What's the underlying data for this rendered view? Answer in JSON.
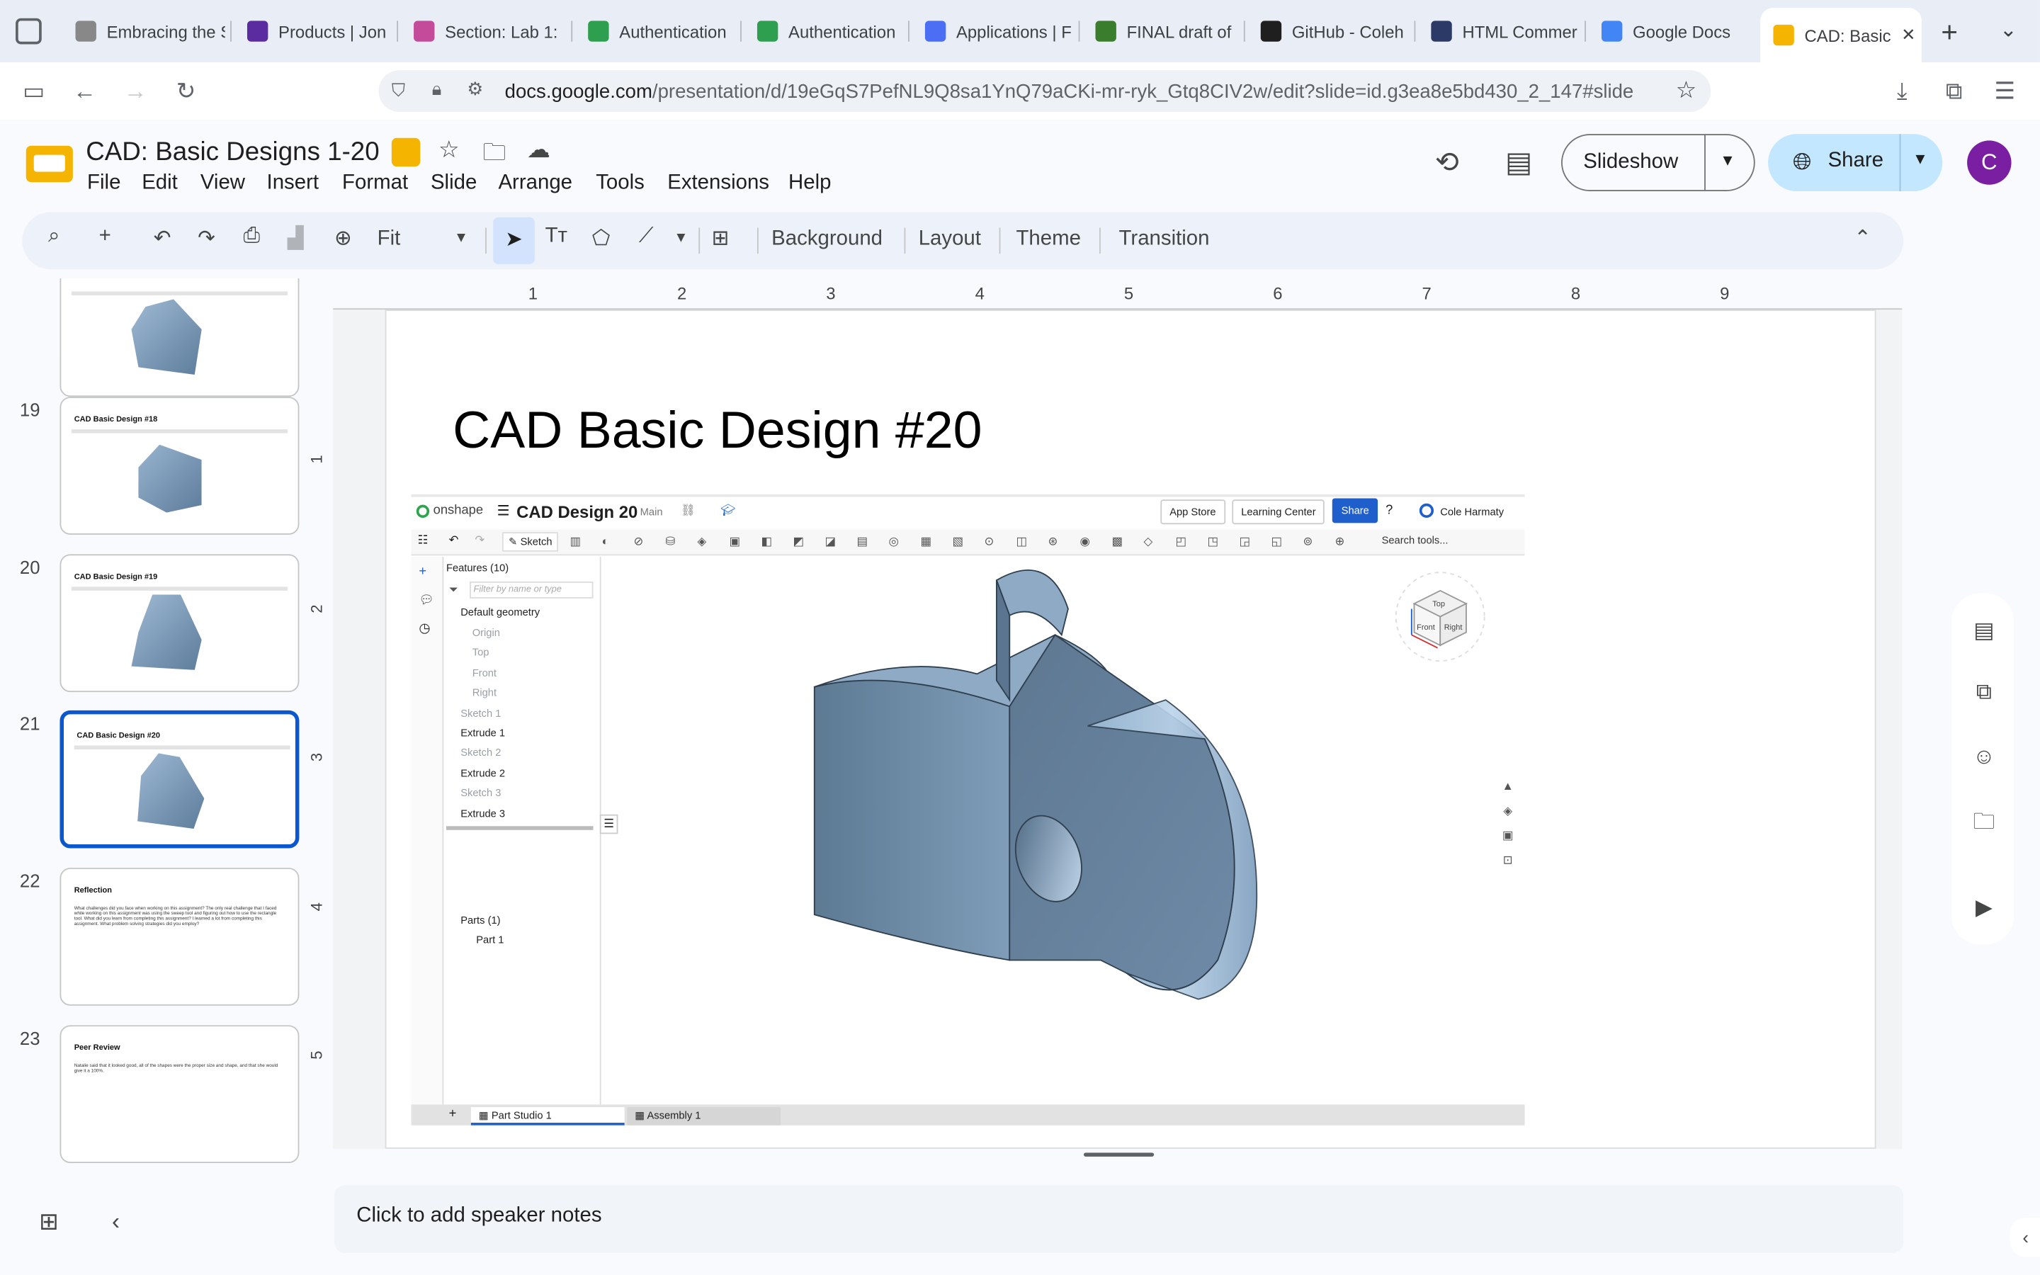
{
  "browser": {
    "tabs": [
      {
        "label": "Embracing the Ste",
        "color": "#888888"
      },
      {
        "label": "Products | Jon",
        "color": "#5a2ca0"
      },
      {
        "label": "Section: Lab 1:",
        "color": "#c44a9a"
      },
      {
        "label": "Authentication",
        "color": "#2e9e4f"
      },
      {
        "label": "Authentication",
        "color": "#2e9e4f"
      },
      {
        "label": "Applications | F",
        "color": "#4c6ef5"
      },
      {
        "label": "FINAL draft of",
        "color": "#3a7d2c"
      },
      {
        "label": "GitHub - Coleh",
        "color": "#1f1f1f"
      },
      {
        "label": "HTML Commer",
        "color": "#2b3a67"
      },
      {
        "label": "Google Docs",
        "color": "#4285f4"
      },
      {
        "label": "CAD: Basic",
        "color": "#f5b400"
      }
    ],
    "url_domain": "docs.google.com",
    "url_path": "/presentation/d/19eGqS7PefNL9Q8sa1YnQ79aCKi-mr-ryk_Gtq8CIV2w/edit?slide=id.g3ea8e5bd430_2_147#slide"
  },
  "docs": {
    "title": "CAD: Basic Designs 1-20",
    "menu": [
      "File",
      "Edit",
      "View",
      "Insert",
      "Format",
      "Slide",
      "Arrange",
      "Tools",
      "Extensions",
      "Help"
    ],
    "slideshow_label": "Slideshow",
    "share_label": "Share",
    "avatar_letter": "C",
    "accent": "#0b57d0"
  },
  "toolbar": {
    "zoom": "Fit",
    "background": "Background",
    "layout": "Layout",
    "theme": "Theme",
    "transition": "Transition"
  },
  "ruler": [
    "1",
    "2",
    "3",
    "4",
    "5",
    "6",
    "7",
    "8",
    "9"
  ],
  "vruler": [
    "1",
    "2",
    "3",
    "4",
    "5"
  ],
  "filmstrip": [
    {
      "num": "",
      "title": "",
      "has_model": true
    },
    {
      "num": "19",
      "title": "CAD Basic Design #18",
      "has_model": true
    },
    {
      "num": "20",
      "title": "CAD Basic Design #19",
      "has_model": true
    },
    {
      "num": "21",
      "title": "CAD Basic Design #20",
      "has_model": true,
      "selected": true
    },
    {
      "num": "22",
      "title": "Reflection",
      "has_model": false,
      "body": "What challenges did you face when working on this assignment? The only real challenge that I faced while working on this assignment was using the sweep tool and figuring out how to use the rectangle tool. What did you learn from completing this assignment? I learned a lot from completing this assignment. What problem solving strategies did you employ?"
    },
    {
      "num": "23",
      "title": "Peer Review",
      "has_model": false,
      "body": "Natalie said that it looked good, all of the shapes were the proper size and shape, and that she would give it a 100%."
    }
  ],
  "slide": {
    "title": "CAD Basic Design #20",
    "onshape": {
      "brand": "onshape",
      "doc_title": "CAD Design 20",
      "branch": "Main",
      "app_store": "App Store",
      "learning_center": "Learning Center",
      "share": "Share",
      "user": "Cole Harmaty",
      "sketch": "Sketch",
      "search_tools": "Search tools...",
      "features_header": "Features (10)",
      "filter_placeholder": "Filter by name or type",
      "default_geometry": "Default geometry",
      "features": [
        {
          "name": "Origin",
          "grey": true
        },
        {
          "name": "Top",
          "grey": true
        },
        {
          "name": "Front",
          "grey": true
        },
        {
          "name": "Right",
          "grey": true
        },
        {
          "name": "Sketch 1",
          "grey": true
        },
        {
          "name": "Extrude 1",
          "grey": false
        },
        {
          "name": "Sketch 2",
          "grey": true
        },
        {
          "name": "Extrude 2",
          "grey": false
        },
        {
          "name": "Sketch 3",
          "grey": true
        },
        {
          "name": "Extrude 3",
          "grey": false
        }
      ],
      "parts_header": "Parts (1)",
      "part": "Part 1",
      "tab_part_studio": "Part Studio 1",
      "tab_assembly": "Assembly 1",
      "cube_top": "Top",
      "cube_front": "Front",
      "cube_right": "Right"
    }
  },
  "notes_placeholder": "Click to add speaker notes"
}
